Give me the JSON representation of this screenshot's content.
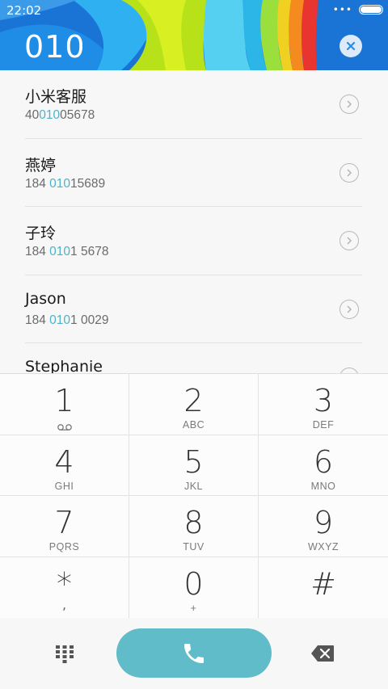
{
  "status_bar": {
    "time": "22:02",
    "signal": "•••",
    "battery_level": 1.0
  },
  "dial": {
    "number": "010"
  },
  "contacts": [
    {
      "name": "小米客服",
      "number_pre": "40",
      "number_match": "010",
      "number_post": "05678"
    },
    {
      "name": "燕婷",
      "number_pre": "184 ",
      "number_match": "010",
      "number_post": "15689"
    },
    {
      "name": "子玲",
      "number_pre": "184 ",
      "number_match": "010",
      "number_post": "1 5678"
    },
    {
      "name": "Jason",
      "number_pre": "184 ",
      "number_match": "010",
      "number_post": "1 0029"
    },
    {
      "name": "Stephanie",
      "number_pre": "",
      "number_match": "",
      "number_post": ""
    }
  ],
  "keypad": [
    {
      "digit": "1",
      "letters": "",
      "extra": "voicemail-icon"
    },
    {
      "digit": "2",
      "letters": "ABC"
    },
    {
      "digit": "3",
      "letters": "DEF"
    },
    {
      "digit": "4",
      "letters": "GHI"
    },
    {
      "digit": "5",
      "letters": "JKL"
    },
    {
      "digit": "6",
      "letters": "MNO"
    },
    {
      "digit": "7",
      "letters": "PQRS"
    },
    {
      "digit": "8",
      "letters": "TUV"
    },
    {
      "digit": "9",
      "letters": "WXYZ"
    },
    {
      "digit": "*",
      "letters": ","
    },
    {
      "digit": "0",
      "letters": "+"
    },
    {
      "digit": "#",
      "letters": ""
    }
  ],
  "colors": {
    "accent": "#4eb3c9",
    "call_button": "#5fbcc8",
    "header_blue": "#1e7fd9"
  },
  "icons": {
    "clear": "clear-x-icon",
    "detail": "chevron-right-circle-icon",
    "dialpad": "dialpad-grid-icon",
    "call": "phone-icon",
    "delete": "backspace-icon"
  }
}
